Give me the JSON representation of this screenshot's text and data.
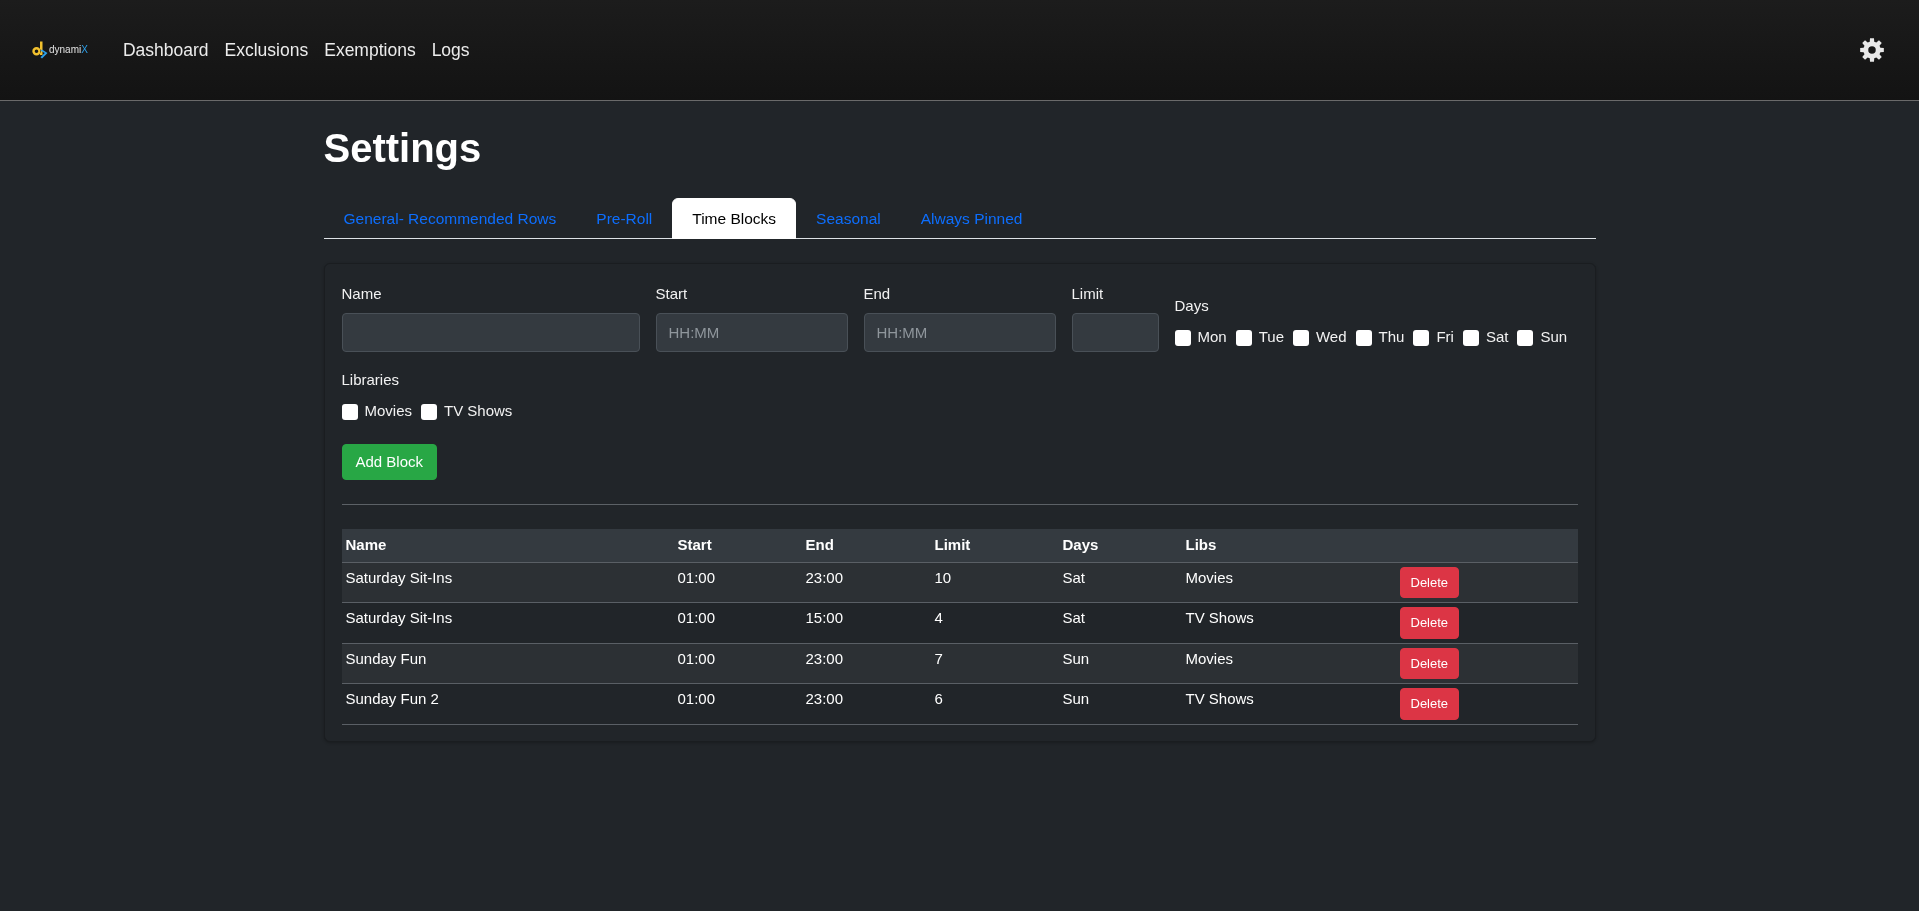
{
  "navbar": {
    "brand": {
      "name": "dynami",
      "accent": "X"
    },
    "links": [
      "Dashboard",
      "Exclusions",
      "Exemptions",
      "Logs"
    ]
  },
  "page": {
    "title": "Settings"
  },
  "tabs": [
    {
      "label": "General- Recommended Rows",
      "selected": false
    },
    {
      "label": "Pre-Roll",
      "selected": false
    },
    {
      "label": "Time Blocks",
      "selected": true
    },
    {
      "label": "Seasonal",
      "selected": false
    },
    {
      "label": "Always Pinned",
      "selected": false
    }
  ],
  "form": {
    "fields": [
      {
        "label": "Name"
      },
      {
        "label": "Start",
        "placeholder": "HH:MM"
      },
      {
        "label": "End",
        "placeholder": "HH:MM"
      },
      {
        "label": "Limit"
      }
    ],
    "days": {
      "label": "Days",
      "options": [
        {
          "label": "Mon",
          "checked": false
        },
        {
          "label": "Tue",
          "checked": false
        },
        {
          "label": "Wed",
          "checked": false
        },
        {
          "label": "Thu",
          "checked": false
        },
        {
          "label": "Fri",
          "checked": false
        },
        {
          "label": "Sat",
          "checked": false
        },
        {
          "label": "Sun",
          "checked": false
        }
      ]
    },
    "libraries": {
      "label": "Libraries",
      "options": [
        {
          "label": "Movies",
          "checked": false
        },
        {
          "label": "TV Shows",
          "checked": false
        }
      ]
    },
    "submit": "Add Block"
  },
  "table": {
    "columns": [
      "Name",
      "Start",
      "End",
      "Limit",
      "Days",
      "Libs"
    ],
    "rows": [
      {
        "cells": [
          "Saturday Sit-Ins",
          "01:00",
          "23:00",
          "10",
          "Sat",
          "Movies"
        ],
        "action": "Delete"
      },
      {
        "cells": [
          "Saturday Sit-Ins",
          "01:00",
          "15:00",
          "4",
          "Sat",
          "TV Shows"
        ],
        "action": "Delete"
      },
      {
        "cells": [
          "Sunday Fun",
          "01:00",
          "23:00",
          "7",
          "Sun",
          "Movies"
        ],
        "action": "Delete"
      },
      {
        "cells": [
          "Sunday Fun 2",
          "01:00",
          "23:00",
          "6",
          "Sun",
          "TV Shows"
        ],
        "action": "Delete"
      }
    ]
  }
}
